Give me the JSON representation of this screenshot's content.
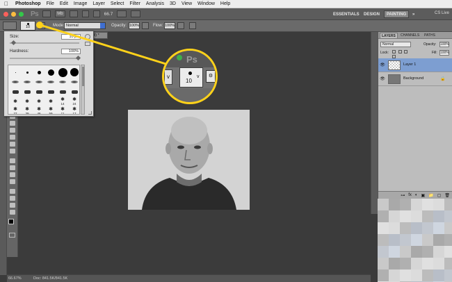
{
  "menubar": {
    "apple": "",
    "app_name": "Photoshop",
    "items": [
      "File",
      "Edit",
      "Image",
      "Layer",
      "Select",
      "Filter",
      "Analysis",
      "3D",
      "View",
      "Window",
      "Help"
    ]
  },
  "appbar": {
    "logo": "Ps",
    "mb_label": "Mb",
    "zoom": "66.7",
    "workspaces": [
      "ESSENTIALS",
      "DESIGN",
      "PAINTING"
    ],
    "active_workspace": "PAINTING",
    "more": "»",
    "cs_live": "CS Live"
  },
  "options": {
    "preset_size": "10",
    "mode_label": "Mode:",
    "mode_value": "Normal",
    "opacity_label": "Opacity:",
    "opacity_value": "100%",
    "flow_label": "Flow:",
    "flow_value": "100%"
  },
  "doc_tab": {
    "label": "B/8) *"
  },
  "brush_picker": {
    "size_label": "Size:",
    "size_value": "10 px",
    "hardness_label": "Hardness:",
    "hardness_value": "100%",
    "size_level": 0.05,
    "hardness_level": 1.0,
    "rows": [
      [
        {
          "kind": "dot",
          "d": 1
        },
        {
          "kind": "dot",
          "d": 3
        },
        {
          "kind": "dot",
          "d": 5
        },
        {
          "kind": "dot",
          "d": 9
        },
        {
          "kind": "dot",
          "d": 13
        },
        {
          "kind": "dot",
          "d": 12
        }
      ],
      [
        {
          "kind": "soft"
        },
        {
          "kind": "soft"
        },
        {
          "kind": "soft"
        },
        {
          "kind": "soft"
        },
        {
          "kind": "soft"
        },
        {
          "kind": "soft"
        }
      ],
      [
        {
          "kind": "shape"
        },
        {
          "kind": "shape"
        },
        {
          "kind": "shape"
        },
        {
          "kind": "shape"
        },
        {
          "kind": "shape"
        },
        {
          "kind": "shape"
        }
      ],
      [
        {
          "kind": "glyph",
          "num": ""
        },
        {
          "kind": "glyph",
          "num": ""
        },
        {
          "kind": "glyph",
          "num": ""
        },
        {
          "kind": "glyph",
          "num": ""
        },
        {
          "kind": "glyph",
          "num": "14"
        },
        {
          "kind": "glyph",
          "num": "24"
        }
      ],
      [
        {
          "kind": "glyph",
          "num": "27"
        },
        {
          "kind": "glyph",
          "num": "39"
        },
        {
          "kind": "glyph",
          "num": "46"
        },
        {
          "kind": "glyph",
          "num": "59"
        },
        {
          "kind": "glyph",
          "num": "11"
        },
        {
          "kind": "glyph",
          "num": "17"
        }
      ]
    ]
  },
  "magnifier": {
    "logo": "Ps",
    "left_char": "v",
    "preset_num": "10",
    "chevron": "v",
    "icon_glyph": "⚙"
  },
  "layers": {
    "tabs": [
      "LAYERS",
      "CHANNELS",
      "PATHS"
    ],
    "active_tab": "LAYERS",
    "blend_mode": "Normal",
    "opacity_label": "Opacity:",
    "opacity_value": "100%",
    "lock_label": "Lock:",
    "fill_label": "Fill:",
    "fill_value": "100%",
    "items": [
      {
        "name": "Layer 1",
        "selected": true,
        "lock": ""
      },
      {
        "name": "Background",
        "selected": false,
        "lock": "🔒"
      }
    ],
    "footer_icons": [
      "fx",
      "◐",
      "▣",
      "📁",
      "▢",
      "🗑"
    ]
  },
  "status": {
    "zoom": "66.67%",
    "doc": "Doc: 841.5K/841.5K"
  },
  "colors": {
    "accent": "#ffd21a",
    "selected_layer": "#7d9ed1",
    "close": "#fc605b",
    "minimize": "#fdbc40",
    "maximize": "#34c84a"
  }
}
